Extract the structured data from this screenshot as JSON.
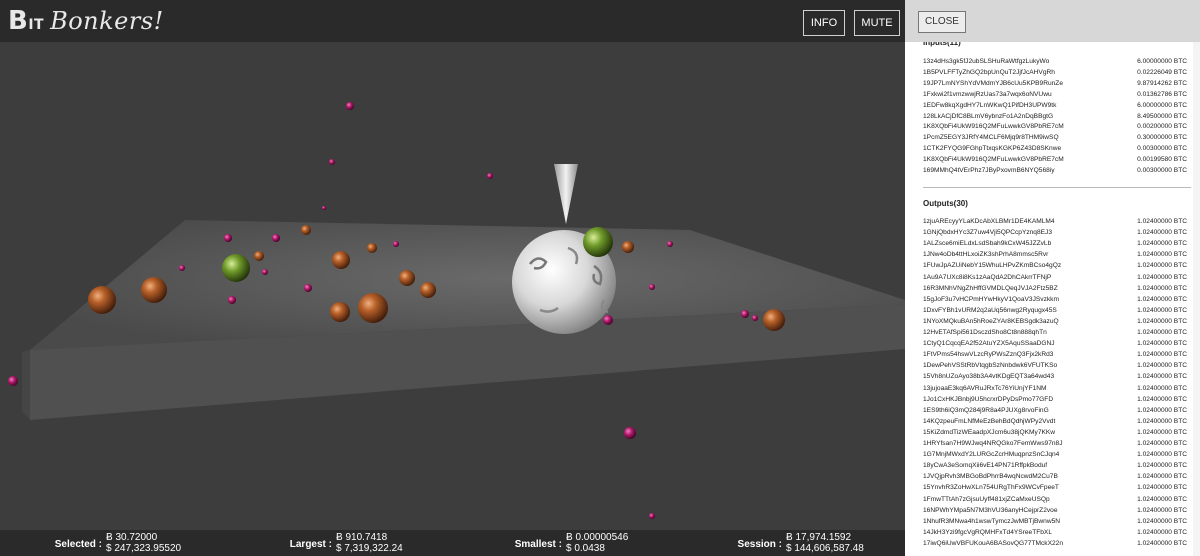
{
  "app": {
    "logo_b": "B",
    "logo_it": "IT",
    "logo_text": "Bonkers!",
    "info_label": "INFO",
    "mute_label": "MUTE",
    "close_label": "CLOSE"
  },
  "stats": {
    "selected": {
      "label": "Selected :",
      "btc": "Ƀ 30.72000",
      "usd": "$ 247,323.95520"
    },
    "largest": {
      "label": "Largest :",
      "btc": "Ƀ 910.7418",
      "usd": "$ 7,319,322.24"
    },
    "smallest": {
      "label": "Smallest :",
      "btc": "Ƀ 0.00000546",
      "usd": "$ 0.0438"
    },
    "session": {
      "label": "Session :",
      "btc": "Ƀ 17,974.1592",
      "usd": "$ 144,606,587.48"
    }
  },
  "inputs": {
    "title": "Inputs(11)",
    "rows": [
      {
        "addr": "13z4dHs3gk5fJ2ubSLSHuRaWtfgzLukyWo",
        "amt": "6.00000000 BTC"
      },
      {
        "addr": "1B5PVLFFTyZhGQ2bpUnQuT2JjfJcAHVgRh",
        "amt": "0.02226049 BTC"
      },
      {
        "addr": "19JP7LmNYShYdVMdmYJB6cUu5KPB9RunZe",
        "amt": "9.87914262 BTC"
      },
      {
        "addr": "1Fxkwi2f1vmzwwjRzUas73a7wqx6oNVUwu",
        "amt": "0.01362786 BTC"
      },
      {
        "addr": "1EDFw8kqXgdHY7LnWKwQ1PifDH3UPW9tk",
        "amt": "6.00000000 BTC"
      },
      {
        "addr": "128LkACjDfC8BLmV6ybnzFo1A2nDqBBgtG",
        "amt": "8.49500000 BTC"
      },
      {
        "addr": "1K8XQbFi4UkW916Q2MFuLwwkGV8PbRE7cM",
        "amt": "0.00200000 BTC"
      },
      {
        "addr": "1PcmZ5EGY3JRfY4MCLF6Mjq9r8THM9iwSQ",
        "amt": "0.30000000 BTC"
      },
      {
        "addr": "1CTK2FYQG9FGhpTtxqsKGKP6Z43D8SKnwe",
        "amt": "0.00300000 BTC"
      },
      {
        "addr": "1K8XQbFi4UkW916Q2MFuLwwkGV8PbRE7cM",
        "amt": "0.00199580 BTC"
      },
      {
        "addr": "169MMhQ4tVErPhz7JByPxovmB6NYQ568iy",
        "amt": "0.00300000 BTC"
      }
    ]
  },
  "outputs": {
    "title": "Outputs(30)",
    "rows": [
      {
        "addr": "1zjuAREcyyYLaKDcAbXLBMr1DE4KAMLM4",
        "amt": "1.02400000 BTC"
      },
      {
        "addr": "1GNjQbdxHYc3Z7uw4Vji5QPCcpYznq8EJ3",
        "amt": "1.02400000 BTC"
      },
      {
        "addr": "1ALZsce6miELdxLsdSbah9kCxW45JZZvLb",
        "amt": "1.02400000 BTC"
      },
      {
        "addr": "1JNw4oDb4ttHLxoiZK3shPrhA8mmsc5Rvr",
        "amt": "1.02400000 BTC"
      },
      {
        "addr": "1FUwJpAZUiNebY15WhuLHPvZKmBCso4gQz",
        "amt": "1.02400000 BTC"
      },
      {
        "addr": "1Au9A7UXc8i8Ks1zAaQdA2DhCAkrrTFNjP",
        "amt": "1.02400000 BTC"
      },
      {
        "addr": "16R3MNhVNgZhHffGVMDLQeqJVJA2Ftz5BZ",
        "amt": "1.02400000 BTC"
      },
      {
        "addr": "15gJoF3u7vHCPmHYwHkyV1QoaV3JSvzkkm",
        "amt": "1.02400000 BTC"
      },
      {
        "addr": "1DxvFYBh1vURM2q2aUq56nwg2Ryqugx45S",
        "amt": "1.02400000 BTC"
      },
      {
        "addr": "1NYoXMQkuBAn5hRoeZYAr8KEBSgdk3azuQ",
        "amt": "1.02400000 BTC"
      },
      {
        "addr": "12HvETAfSpi561DsczdSho8Ct8n888qhTn",
        "amt": "1.02400000 BTC"
      },
      {
        "addr": "1CtyQ1CqcqEA2f52AtuYZX5AquSSaaDGNJ",
        "amt": "1.02400000 BTC"
      },
      {
        "addr": "1FtVPms54hswVLzcRyPWsZznQ3Fjx2kRd3",
        "amt": "1.02400000 BTC"
      },
      {
        "addr": "1DewPehVSStRbVtqgbSzNnbdwk6VFUTKSo",
        "amt": "1.02400000 BTC"
      },
      {
        "addr": "15Vh8nUZoAyo38b3A4vtKDgEQT3a64wd43",
        "amt": "1.02400000 BTC"
      },
      {
        "addr": "13jujoaaE3kq6AVRuJRxTc76YiUnjYF1NM",
        "amt": "1.02400000 BTC"
      },
      {
        "addr": "1Jo1CxHKJBnbj9U5hcrxrDPyDsPmo77GFD",
        "amt": "1.02400000 BTC"
      },
      {
        "addr": "1ES9th6iQ3mQ284j9R8a4PJUXg8rvoFinG",
        "amt": "1.02400000 BTC"
      },
      {
        "addr": "14KQzpeuFmLNfMeEzBehBdQdhjWPy2Vvdt",
        "amt": "1.02400000 BTC"
      },
      {
        "addr": "15KiZdmdTizWEaadpXJcm6u38jQKMy7KKw",
        "amt": "1.02400000 BTC"
      },
      {
        "addr": "1HRYfsan7H9WJwq4NRQGko7FemWws97n8J",
        "amt": "1.02400000 BTC"
      },
      {
        "addr": "1G7MnjMWxdY2LURGcZcrHMuqpnzSnCJqn4",
        "amt": "1.02400000 BTC"
      },
      {
        "addr": "18yCwA3eSomqXii6vE14PN71RffpkBoduf",
        "amt": "1.02400000 BTC"
      },
      {
        "addr": "1JVQjpRvh3MBGoBdPhrrB4wqNcwdM2Cu7B",
        "amt": "1.02400000 BTC"
      },
      {
        "addr": "15YnvhR3ZoHwXLn754URgThFx9WCvFpeeT",
        "amt": "1.02400000 BTC"
      },
      {
        "addr": "1FmwTTtAh7zGjsuUyff481xjZCaMxeUSQp",
        "amt": "1.02400000 BTC"
      },
      {
        "addr": "16NPWhYMpa5N7M3hVU36anyHCejprZ2voe",
        "amt": "1.02400000 BTC"
      },
      {
        "addr": "1NhufR3MNwa4h1wswTymczJwMBTjBwnw5N",
        "amt": "1.02400000 BTC"
      },
      {
        "addr": "14JkH3Yzi9fgcVgRQMHFxTd4YSreeTFbXL",
        "amt": "1.02400000 BTC"
      },
      {
        "addr": "17iwQ6iUwVBFUKouA6BASovQG77TMckX22n",
        "amt": "1.02400000 BTC"
      }
    ]
  },
  "colors": {
    "scene_bg": "#3d3d3d",
    "bar_bg": "#2a2a2a",
    "panel_bg": "#ffffff",
    "coin_bronze": "#b8612a",
    "coin_green": "#6f9a2a",
    "coin_magenta": "#b0186a",
    "whale_white": "#e4e4e4"
  }
}
